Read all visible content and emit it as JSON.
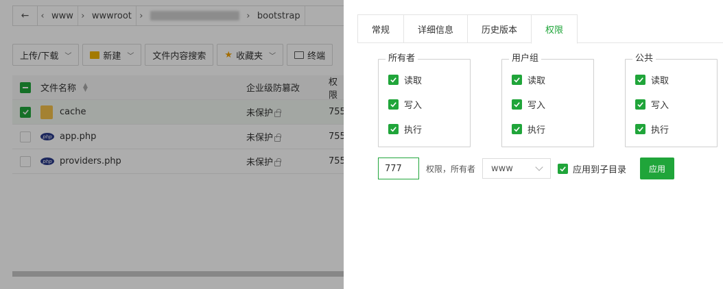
{
  "file_manager": {
    "address": {
      "back_icon": "arrow-left-icon",
      "crumbs": [
        "www",
        "wwwroot",
        "bootstrap"
      ]
    },
    "toolbar": {
      "upload_download": "上传/下载",
      "new": "新建",
      "content_search": "文件内容搜索",
      "favorites": "收藏夹",
      "terminal": "终端"
    },
    "table": {
      "headers": {
        "name": "文件名称",
        "protection": "企业级防篡改",
        "permission": "权限"
      },
      "rows": [
        {
          "name": "cache",
          "type": "folder",
          "protection": "未保护",
          "permission": "755",
          "selected": true
        },
        {
          "name": "app.php",
          "type": "php",
          "protection": "未保护",
          "permission": "755",
          "selected": false
        },
        {
          "name": "providers.php",
          "type": "php",
          "protection": "未保护",
          "permission": "755",
          "selected": false
        }
      ]
    }
  },
  "panel": {
    "tabs": [
      "常规",
      "详细信息",
      "历史版本",
      "权限"
    ],
    "active_tab": "权限",
    "groups": [
      {
        "title": "所有者",
        "items": [
          {
            "label": "读取",
            "checked": true
          },
          {
            "label": "写入",
            "checked": true
          },
          {
            "label": "执行",
            "checked": true
          }
        ]
      },
      {
        "title": "用户组",
        "items": [
          {
            "label": "读取",
            "checked": true
          },
          {
            "label": "写入",
            "checked": true
          },
          {
            "label": "执行",
            "checked": true
          }
        ]
      },
      {
        "title": "公共",
        "items": [
          {
            "label": "读取",
            "checked": true
          },
          {
            "label": "写入",
            "checked": true
          },
          {
            "label": "执行",
            "checked": true
          }
        ]
      }
    ],
    "mode_value": "777",
    "owner_label": "权限，所有者",
    "owner_value": "www",
    "apply_subdir_label": "应用到子目录",
    "apply_subdir_checked": true,
    "apply_button": "应用"
  },
  "colors": {
    "accent": "#20a53a",
    "overlay": "rgba(0,0,0,0.32)"
  }
}
